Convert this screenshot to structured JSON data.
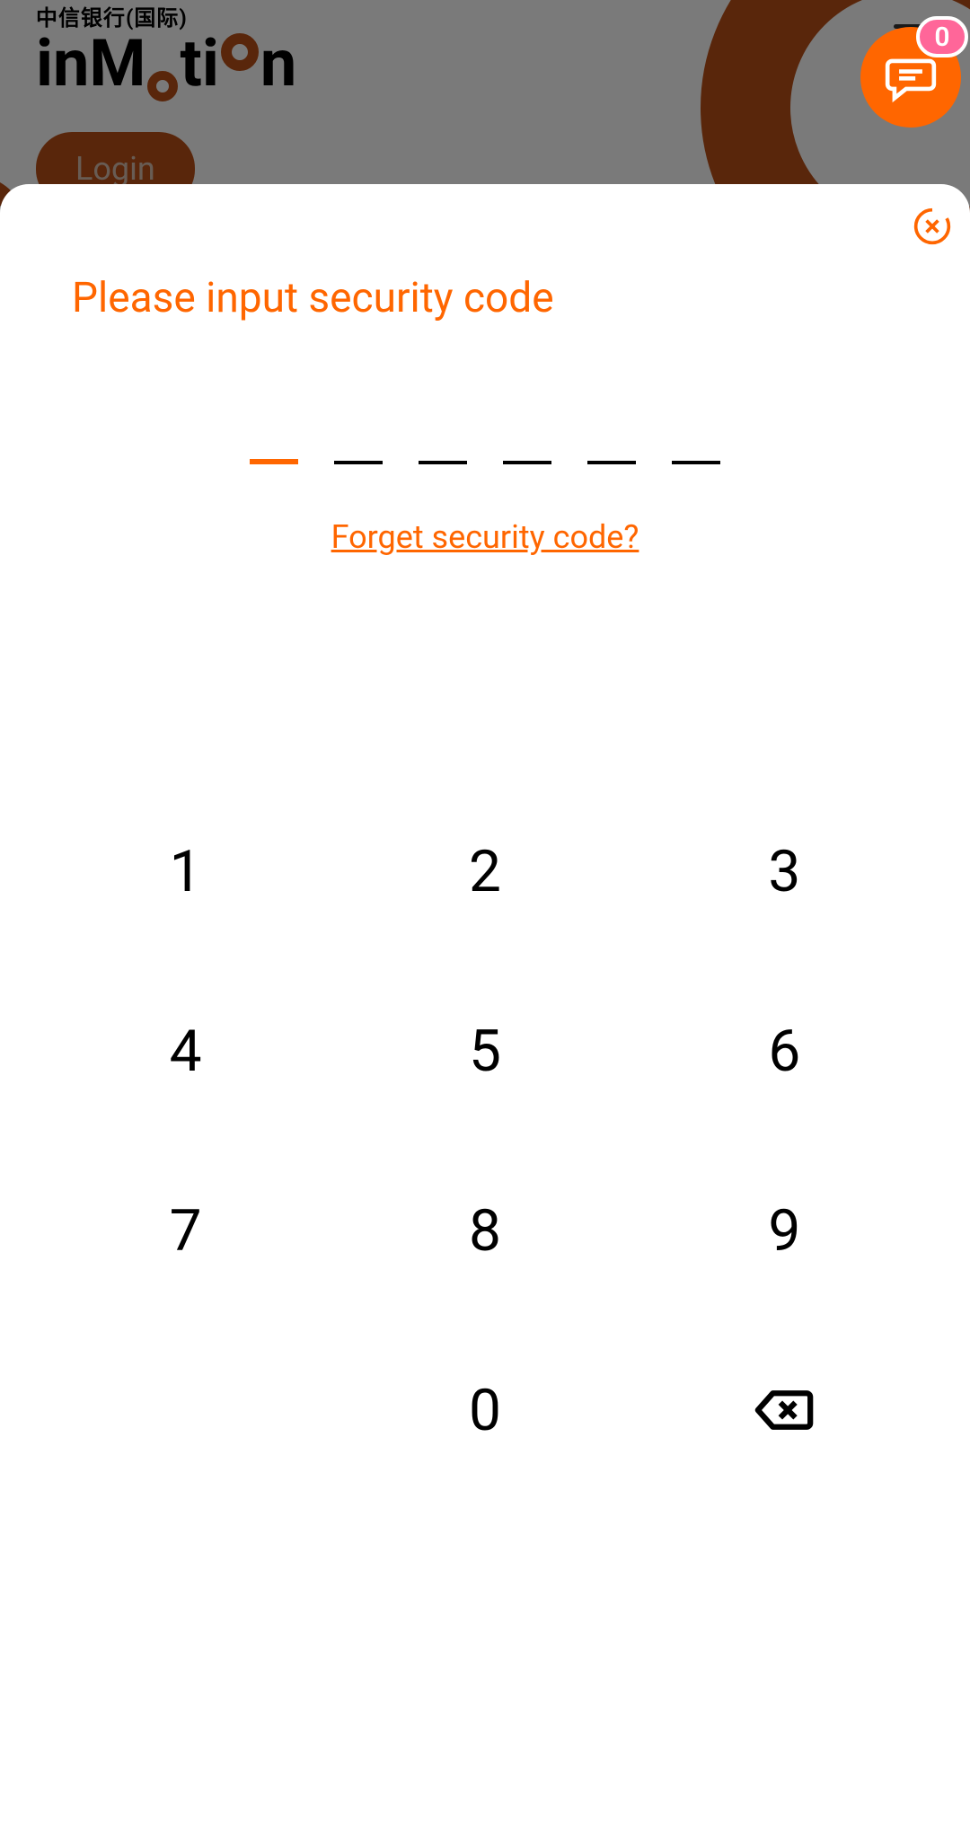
{
  "brand": {
    "subtitle": "中信银行(国际)",
    "name_parts": {
      "p1": "inM",
      "p2": "ti",
      "p3": "n"
    }
  },
  "header": {
    "login_label": "Login"
  },
  "chat": {
    "badge_count": "0"
  },
  "modal": {
    "prompt": "Please input security code",
    "forget_link": "Forget security code?",
    "code_length": 6,
    "active_index": 0
  },
  "keypad": {
    "rows": [
      [
        "1",
        "2",
        "3"
      ],
      [
        "4",
        "5",
        "6"
      ],
      [
        "7",
        "8",
        "9"
      ],
      [
        "",
        "0",
        "backspace"
      ]
    ]
  }
}
